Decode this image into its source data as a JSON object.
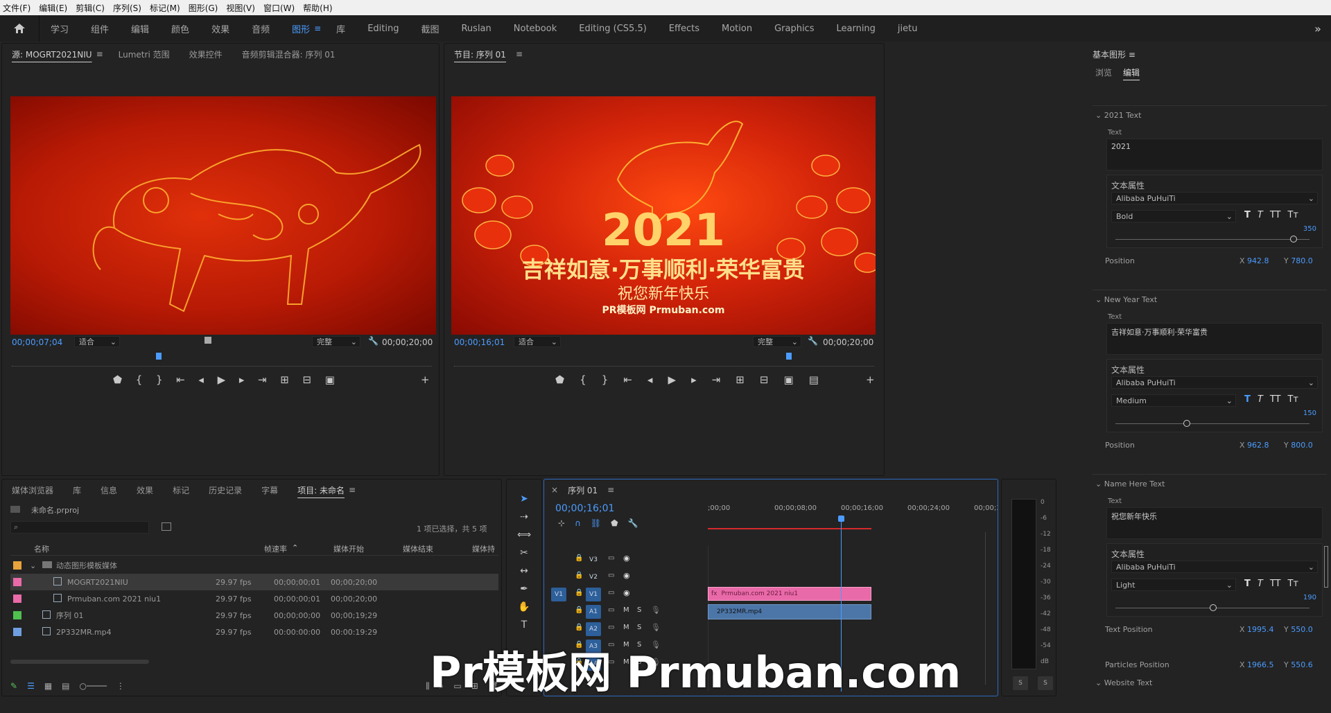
{
  "menu": [
    "文件(F)",
    "编辑(E)",
    "剪辑(C)",
    "序列(S)",
    "标记(M)",
    "图形(G)",
    "视图(V)",
    "窗口(W)",
    "帮助(H)"
  ],
  "workspaces": [
    "学习",
    "组件",
    "编辑",
    "颜色",
    "效果",
    "音频",
    "图形",
    "库",
    "Editing",
    "截图",
    "Ruslan",
    "Notebook",
    "Editing (CS5.5)",
    "Effects",
    "Motion",
    "Graphics",
    "Learning",
    "jietu"
  ],
  "source": {
    "tabs": [
      "源: MOGRT2021NIU",
      "Lumetri 范围",
      "效果控件",
      "音频剪辑混合器: 序列 01"
    ],
    "timecode": "00;00;07;04",
    "fit": "适合",
    "quality": "完整",
    "duration": "00;00;20;00"
  },
  "program": {
    "tab": "节目: 序列 01",
    "timecode": "00;00;16;01",
    "fit": "适合",
    "quality": "完整",
    "duration": "00;00;20;00",
    "year": "2021",
    "line1": "吉祥如意·万事顺利·荣华富贵",
    "line2": "祝您新年快乐",
    "line3": "PR模板网 Prmuban.com"
  },
  "project": {
    "tabs": [
      "媒体浏览器",
      "库",
      "信息",
      "效果",
      "标记",
      "历史记录",
      "字幕",
      "项目: 未命名"
    ],
    "file": "未命名.prproj",
    "selection": "1 项已选择，共 5 项",
    "columns": [
      "名称",
      "帧速率",
      "媒体开始",
      "媒体结束",
      "媒体持"
    ],
    "rows": [
      {
        "name": "动态图形模板媒体",
        "fps": "",
        "start": "",
        "end": "",
        "color": "#e8a33c",
        "indent": 0,
        "folder": true
      },
      {
        "name": "MOGRT2021NIU",
        "fps": "29.97 fps",
        "start": "00;00;00;01",
        "end": "00;00;20;00",
        "color": "#e96aa8",
        "indent": 1
      },
      {
        "name": "Prmuban.com 2021 niu1",
        "fps": "29.97 fps",
        "start": "00;00;00;01",
        "end": "00;00;20;00",
        "color": "#e96aa8",
        "indent": 1
      },
      {
        "name": "序列 01",
        "fps": "29.97 fps",
        "start": "00;00;00;00",
        "end": "00;00;19;29",
        "color": "#4fbf4f",
        "indent": 0
      },
      {
        "name": "2P332MR.mp4",
        "fps": "29.97 fps",
        "start": "00:00:00:00",
        "end": "00:00:19:29",
        "color": "#6f9fe0",
        "indent": 0
      }
    ]
  },
  "timeline": {
    "tab": "序列 01",
    "timecode": "00;00;16;01",
    "ruler": [
      ";00;00",
      "00;00;08;00",
      "00;00;16;00",
      "00;00;24;00",
      "00;00;32"
    ],
    "tracks": [
      "V3",
      "V2",
      "V1",
      "A1",
      "A2",
      "A3",
      "A4"
    ],
    "clip_video": "Prmuban.com 2021 niu1",
    "clip_audio": "2P332MR.mp4"
  },
  "meter": {
    "ticks": [
      "0",
      "-6",
      "-12",
      "-18",
      "-24",
      "-30",
      "-36",
      "-42",
      "-48",
      "-54",
      "dB"
    ],
    "solo": [
      "S",
      "S"
    ]
  },
  "eg": {
    "title": "基本图形",
    "tabs": [
      "浏览",
      "编辑"
    ],
    "sections": [
      {
        "name": "2021 Text",
        "text": "2021",
        "font": "Alibaba PuHuiTi",
        "style": "Bold",
        "size": "350",
        "poslabel": "Position",
        "x": "942.8",
        "y": "780.0"
      },
      {
        "name": "New Year Text",
        "text": "吉祥如意·万事顺利·荣华富贵",
        "font": "Alibaba PuHuiTi",
        "style": "Medium",
        "size": "150",
        "poslabel": "Position",
        "x": "962.8",
        "y": "800.0"
      },
      {
        "name": "Name Here Text",
        "text": "祝您新年快乐",
        "font": "Alibaba PuHuiTi",
        "style": "Light",
        "size": "190",
        "poslabel": "Text Position",
        "x": "1995.4",
        "y": "550.0"
      }
    ],
    "particles_label": "Particles Position",
    "px": "1966.5",
    "py": "550.6",
    "website": "Website Text",
    "text_label": "Text",
    "attr_label": "文本属性"
  },
  "watermark": "Pr模板网 Prmuban.com"
}
